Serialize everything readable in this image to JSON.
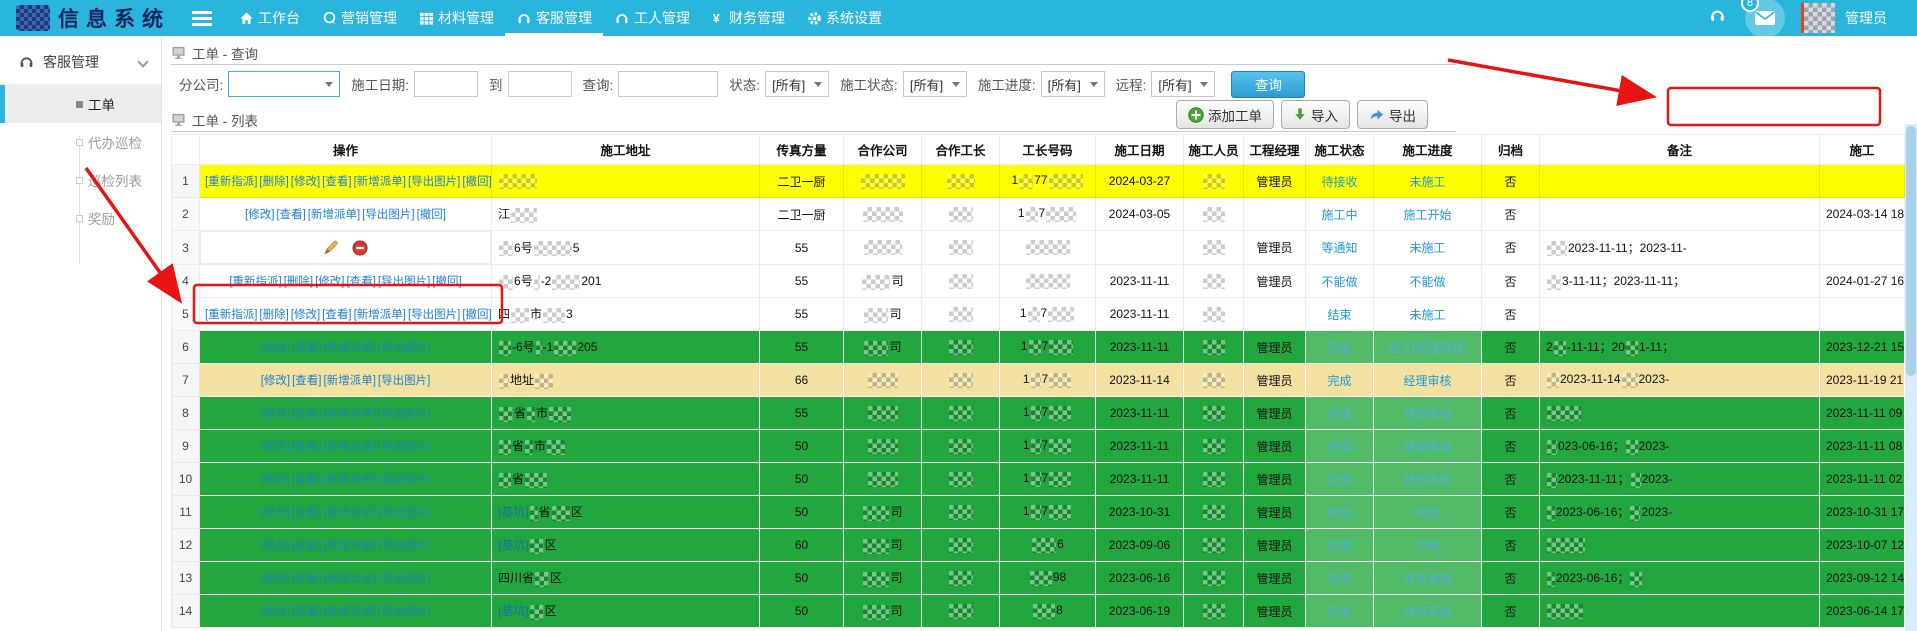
{
  "topbar": {
    "brand": "信息系统",
    "nav": [
      {
        "label": "工作台",
        "icon": "home-icon",
        "active": false
      },
      {
        "label": "营销管理",
        "icon": "chat-icon",
        "active": false
      },
      {
        "label": "材料管理",
        "icon": "grid-icon",
        "active": false
      },
      {
        "label": "客服管理",
        "icon": "headset-icon",
        "active": true
      },
      {
        "label": "工人管理",
        "icon": "headset-icon",
        "active": false
      },
      {
        "label": "财务管理",
        "icon": "yen-icon",
        "active": false
      },
      {
        "label": "系统设置",
        "icon": "gear-icon",
        "active": false
      }
    ],
    "message_badge": "8",
    "username": "管理员"
  },
  "sidebar": {
    "header": "客服管理",
    "items": [
      {
        "label": "工单",
        "active": true
      },
      {
        "label": "代办巡检",
        "active": false
      },
      {
        "label": "巡检列表",
        "active": false
      },
      {
        "label": "奖励",
        "active": false
      }
    ]
  },
  "query_panel": {
    "title": "工单 - 查询",
    "filters": {
      "company_label": "分公司:",
      "date_label": "施工日期:",
      "to_label": "到",
      "search_label": "查询:",
      "status_label": "状态:",
      "cons_status_label": "施工状态:",
      "progress_label": "施工进度:",
      "remote_label": "远程:",
      "all_option": "[所有]",
      "search_button": "查询"
    }
  },
  "list_panel": {
    "title": "工单 - 列表",
    "buttons": [
      {
        "label": "添加工单",
        "icon": "plus-circle-icon"
      },
      {
        "label": "导入",
        "icon": "import-arrow-icon"
      },
      {
        "label": "导出",
        "icon": "export-arrow-icon"
      }
    ]
  },
  "annotation_color": "#e81414",
  "table": {
    "headers": [
      "",
      "操作",
      "施工地址",
      "传真方量",
      "合作公司",
      "合作工长",
      "工长号码",
      "施工日期",
      "施工人员",
      "工程经理",
      "施工状态",
      "施工进度",
      "归档",
      "备注",
      "施工"
    ],
    "rows": [
      {
        "num": "1",
        "bg": "yellow",
        "ops": [
          "[重新指派]",
          "[删除]",
          "[修改]",
          "[查看]",
          "[新增派单]",
          "[导出图片]",
          "[撤回]"
        ],
        "addr": [
          {
            "b": 38
          }
        ],
        "fax": "二卫一厨",
        "company": [
          {
            "b": 44
          }
        ],
        "foreman": [
          {
            "b": 28
          }
        ],
        "phone": [
          {
            "t": "1"
          },
          {
            "b": 14
          },
          {
            "t": "77"
          },
          {
            "b": 34
          }
        ],
        "date": "2024-03-27",
        "worker": [
          {
            "b": 22
          }
        ],
        "manager": "管理员",
        "status": "待接收",
        "progress": "未施工",
        "archive": "否",
        "remark": [],
        "last": ""
      },
      {
        "num": "2",
        "bg": "white",
        "ops": [
          "[修改]",
          "[查看]",
          "[新增派单]",
          "[导出图片]",
          "[撤回]"
        ],
        "addr": [
          {
            "t": "江"
          },
          {
            "b": 26
          }
        ],
        "fax": "二卫一厨",
        "company": [
          {
            "b": 40
          }
        ],
        "foreman": [
          {
            "b": 24
          }
        ],
        "phone": [
          {
            "t": "1"
          },
          {
            "b": 12
          },
          {
            "t": "7"
          },
          {
            "b": 30
          }
        ],
        "date": "2024-03-05",
        "worker": [
          {
            "b": 22
          }
        ],
        "manager": "",
        "status": "施工中",
        "progress": "施工开始",
        "archive": "否",
        "remark": [],
        "last": "2024-03-14 18"
      },
      {
        "num": "3",
        "bg": "white",
        "ops_icons": true,
        "addr": [
          {
            "b": 14
          },
          {
            "t": "6号"
          },
          {
            "b": 38
          },
          {
            "t": "5"
          }
        ],
        "fax": "55",
        "company": [
          {
            "b": 38
          }
        ],
        "foreman": [
          {
            "b": 24
          }
        ],
        "phone": [
          {
            "b": 44
          }
        ],
        "date": "",
        "worker": [
          {
            "b": 22
          }
        ],
        "manager": "管理员",
        "status": "等通知",
        "progress": "未施工",
        "archive": "否",
        "remark": [
          {
            "b": 20
          },
          {
            "t": "2023-11-11；2023-11-"
          }
        ],
        "last": ""
      },
      {
        "num": "4",
        "bg": "white",
        "ops": [
          "[重新指派]",
          "[删除]",
          "[修改]",
          "[查看]",
          "[导出图片]",
          "[撤回]"
        ],
        "addr": [
          {
            "b": 14
          },
          {
            "t": "6号"
          },
          {
            "b": 6
          },
          {
            "t": "-2"
          },
          {
            "b": 28
          },
          {
            "t": "201"
          }
        ],
        "fax": "55",
        "company": [
          {
            "b": 28
          },
          {
            "t": "司"
          }
        ],
        "foreman": [
          {
            "b": 24
          }
        ],
        "phone": [
          {
            "b": 44
          }
        ],
        "date": "2023-11-11",
        "worker": [
          {
            "b": 22
          }
        ],
        "manager": "管理员",
        "status": "不能做",
        "progress": "不能做",
        "archive": "否",
        "remark": [
          {
            "b": 14
          },
          {
            "t": "3-11-11；2023-11-11；"
          }
        ],
        "last": "2024-01-27 16"
      },
      {
        "num": "5",
        "bg": "white",
        "ops": [
          "[重新指派]",
          "[删除]",
          "[修改]",
          "[查看]",
          "[新增派单]",
          "[导出图片]",
          "[撤回]"
        ],
        "addr": [
          {
            "t": "四"
          },
          {
            "b": 18
          },
          {
            "t": "市"
          },
          {
            "b": 22
          },
          {
            "t": "3"
          }
        ],
        "fax": "55",
        "company": [
          {
            "b": 24
          },
          {
            "t": "司"
          }
        ],
        "foreman": [
          {
            "b": 24
          }
        ],
        "phone": [
          {
            "t": "1"
          },
          {
            "b": 12
          },
          {
            "t": "7"
          },
          {
            "b": 26
          }
        ],
        "date": "2023-11-11",
        "worker": [
          {
            "b": 22
          }
        ],
        "manager": "",
        "status": "结束",
        "progress": "未施工",
        "archive": "否",
        "remark": [],
        "last": ""
      },
      {
        "num": "6",
        "bg": "green",
        "ops": [
          "[修改]",
          "[查看]",
          "[新增派单]",
          "[导出图片]"
        ],
        "addr": [
          {
            "b": 12
          },
          {
            "t": "-6号"
          },
          {
            "b": 6
          },
          {
            "t": "-1"
          },
          {
            "b": 22
          },
          {
            "t": "205"
          }
        ],
        "fax": "55",
        "company": [
          {
            "b": 24
          },
          {
            "t": "司"
          }
        ],
        "foreman": [
          {
            "b": 24
          }
        ],
        "phone": [
          {
            "t": "1"
          },
          {
            "b": 12
          },
          {
            "t": "7"
          },
          {
            "b": 24
          }
        ],
        "date": "2023-11-11",
        "worker": [
          {
            "b": 22
          }
        ],
        "manager": "管理员",
        "status": "完成",
        "progress": "返工[经理审核]",
        "archive": "否",
        "remark": [
          {
            "t": "2"
          },
          {
            "b": 12
          },
          {
            "t": "-11-11；20"
          },
          {
            "b": 12
          },
          {
            "t": "1-11；"
          }
        ],
        "last": "2023-12-21 15"
      },
      {
        "num": "7",
        "bg": "khaki",
        "ops": [
          "[修改]",
          "[查看]",
          "[新增派单]",
          "[导出图片]"
        ],
        "addr": [
          {
            "b": 10
          },
          {
            "t": "地址"
          },
          {
            "b": 18
          }
        ],
        "fax": "66",
        "company": [
          {
            "b": 30
          }
        ],
        "foreman": [
          {
            "b": 24
          }
        ],
        "phone": [
          {
            "t": "1"
          },
          {
            "b": 10
          },
          {
            "t": "7"
          },
          {
            "b": 22
          }
        ],
        "date": "2023-11-14",
        "worker": [
          {
            "b": 22
          }
        ],
        "manager": "管理员",
        "status": "完成",
        "progress": "经理审核",
        "archive": "否",
        "remark": [
          {
            "b": 12
          },
          {
            "t": "2023-11-14"
          },
          {
            "b": 16
          },
          {
            "t": "2023-"
          }
        ],
        "last": "2023-11-19 21"
      },
      {
        "num": "8",
        "bg": "green",
        "ops": [
          "[修改]",
          "[查看]",
          "[新增派单]",
          "[导出图片]"
        ],
        "addr": [
          {
            "b": 14
          },
          {
            "t": "省"
          },
          {
            "b": 8
          },
          {
            "t": "市"
          },
          {
            "b": 22
          }
        ],
        "fax": "55",
        "company": [
          {
            "b": 30
          }
        ],
        "foreman": [
          {
            "b": 24
          }
        ],
        "phone": [
          {
            "t": "1"
          },
          {
            "b": 10
          },
          {
            "t": "7"
          },
          {
            "b": 22
          }
        ],
        "date": "2023-11-11",
        "worker": [
          {
            "b": 22
          }
        ],
        "manager": "管理员",
        "status": "完成",
        "progress": "经理审核",
        "archive": "否",
        "remark": [
          {
            "b": 34
          }
        ],
        "last": "2023-11-11 09"
      },
      {
        "num": "9",
        "bg": "green",
        "ops": [
          "[修改]",
          "[查看]",
          "[新增派单]",
          "[导出图片]"
        ],
        "addr": [
          {
            "b": 12
          },
          {
            "t": "省"
          },
          {
            "b": 8
          },
          {
            "t": "市"
          },
          {
            "b": 18
          }
        ],
        "fax": "50",
        "company": [
          {
            "b": 30
          }
        ],
        "foreman": [
          {
            "b": 24
          }
        ],
        "phone": [
          {
            "t": "1"
          },
          {
            "b": 10
          },
          {
            "t": "7"
          },
          {
            "b": 22
          }
        ],
        "date": "2023-11-11",
        "worker": [
          {
            "b": 22
          }
        ],
        "manager": "管理员",
        "status": "完成",
        "progress": "经理审核",
        "archive": "否",
        "remark": [
          {
            "b": 10
          },
          {
            "t": "023-06-16；"
          },
          {
            "b": 12
          },
          {
            "t": "2023-"
          }
        ],
        "last": "2023-11-11 08"
      },
      {
        "num": "10",
        "bg": "green",
        "ops": [
          "[修改]",
          "[查看]",
          "[新增派单]",
          "[导出图片]"
        ],
        "addr": [
          {
            "b": 12
          },
          {
            "t": "省"
          },
          {
            "b": 22
          }
        ],
        "fax": "50",
        "company": [
          {
            "b": 30
          }
        ],
        "foreman": [
          {
            "b": 24
          }
        ],
        "phone": [
          {
            "t": "1"
          },
          {
            "b": 10
          },
          {
            "t": "7"
          },
          {
            "b": 22
          }
        ],
        "date": "2023-11-11",
        "worker": [
          {
            "b": 22
          }
        ],
        "manager": "管理员",
        "status": "完成",
        "progress": "绩效审核",
        "archive": "否",
        "remark": [
          {
            "b": 10
          },
          {
            "t": "2023-11-11；"
          },
          {
            "b": 10
          },
          {
            "t": "2023-"
          }
        ],
        "last": "2023-11-11 02"
      },
      {
        "num": "11",
        "bg": "green",
        "ops": [
          "[修改]",
          "[查看]",
          "[新增派单]",
          "[导出图片]"
        ],
        "addr": [
          {
            "t": "[基坑]",
            "link": true
          },
          {
            "b": 8
          },
          {
            "t": "省"
          },
          {
            "b": 18
          },
          {
            "t": "区"
          }
        ],
        "fax": "50",
        "company": [
          {
            "b": 26
          },
          {
            "t": "司"
          }
        ],
        "foreman": [
          {
            "b": 24
          }
        ],
        "phone": [
          {
            "t": "1"
          },
          {
            "b": 10
          },
          {
            "t": "7"
          },
          {
            "b": 22
          }
        ],
        "date": "2023-10-31",
        "worker": [
          {
            "b": 22
          }
        ],
        "manager": "管理员",
        "status": "完成",
        "progress": "完成",
        "archive": "否",
        "remark": [
          {
            "b": 8
          },
          {
            "t": "2023-06-16；"
          },
          {
            "b": 10
          },
          {
            "t": "2023-"
          }
        ],
        "last": "2023-10-31 17"
      },
      {
        "num": "12",
        "bg": "green",
        "ops": [
          "[修改]",
          "[查看]",
          "[新增派单]",
          "[导出图片]"
        ],
        "addr": [
          {
            "t": "[基坑]",
            "link": true
          },
          {
            "b": 14
          },
          {
            "t": "区"
          }
        ],
        "fax": "60",
        "company": [
          {
            "b": 26
          },
          {
            "t": "司"
          }
        ],
        "foreman": [
          {
            "b": 24
          }
        ],
        "phone": [
          {
            "b": 24
          },
          {
            "t": "6"
          }
        ],
        "date": "2023-09-06",
        "worker": [
          {
            "b": 22
          }
        ],
        "manager": "管理员",
        "status": "完成",
        "progress": "完成",
        "archive": "否",
        "remark": [
          {
            "b": 38
          }
        ],
        "last": "2023-10-07 12"
      },
      {
        "num": "13",
        "bg": "green",
        "ops": [
          "[修改]",
          "[查看]",
          "[新增派单]",
          "[导出图片]"
        ],
        "addr": [
          {
            "t": "四川省"
          },
          {
            "b": 14
          },
          {
            "t": "区"
          }
        ],
        "fax": "50",
        "company": [
          {
            "b": 26
          },
          {
            "t": "司"
          }
        ],
        "foreman": [
          {
            "b": 24
          }
        ],
        "phone": [
          {
            "b": 22
          },
          {
            "t": "98"
          }
        ],
        "date": "2023-06-16",
        "worker": [
          {
            "b": 22
          }
        ],
        "manager": "管理员",
        "status": "完成",
        "progress": "财务审核",
        "archive": "否",
        "remark": [
          {
            "b": 8
          },
          {
            "t": "2023-06-16；"
          },
          {
            "b": 12
          }
        ],
        "last": "2023-09-12 14"
      },
      {
        "num": "14",
        "bg": "green",
        "ops": [
          "[修改]",
          "[查看]",
          "[新增派单]",
          "[导出图片]"
        ],
        "addr": [
          {
            "t": "[基坑]",
            "link": true
          },
          {
            "b": 14
          },
          {
            "t": "区"
          }
        ],
        "fax": "50",
        "company": [
          {
            "b": 26
          },
          {
            "t": "司"
          }
        ],
        "foreman": [
          {
            "b": 24
          }
        ],
        "phone": [
          {
            "b": 22
          },
          {
            "t": "8"
          }
        ],
        "date": "2023-06-19",
        "worker": [
          {
            "b": 22
          }
        ],
        "manager": "管理员",
        "status": "完成",
        "progress": "财务审核",
        "archive": "否",
        "remark": [
          {
            "b": 36
          }
        ],
        "last": "2023-06-14 17"
      }
    ]
  }
}
